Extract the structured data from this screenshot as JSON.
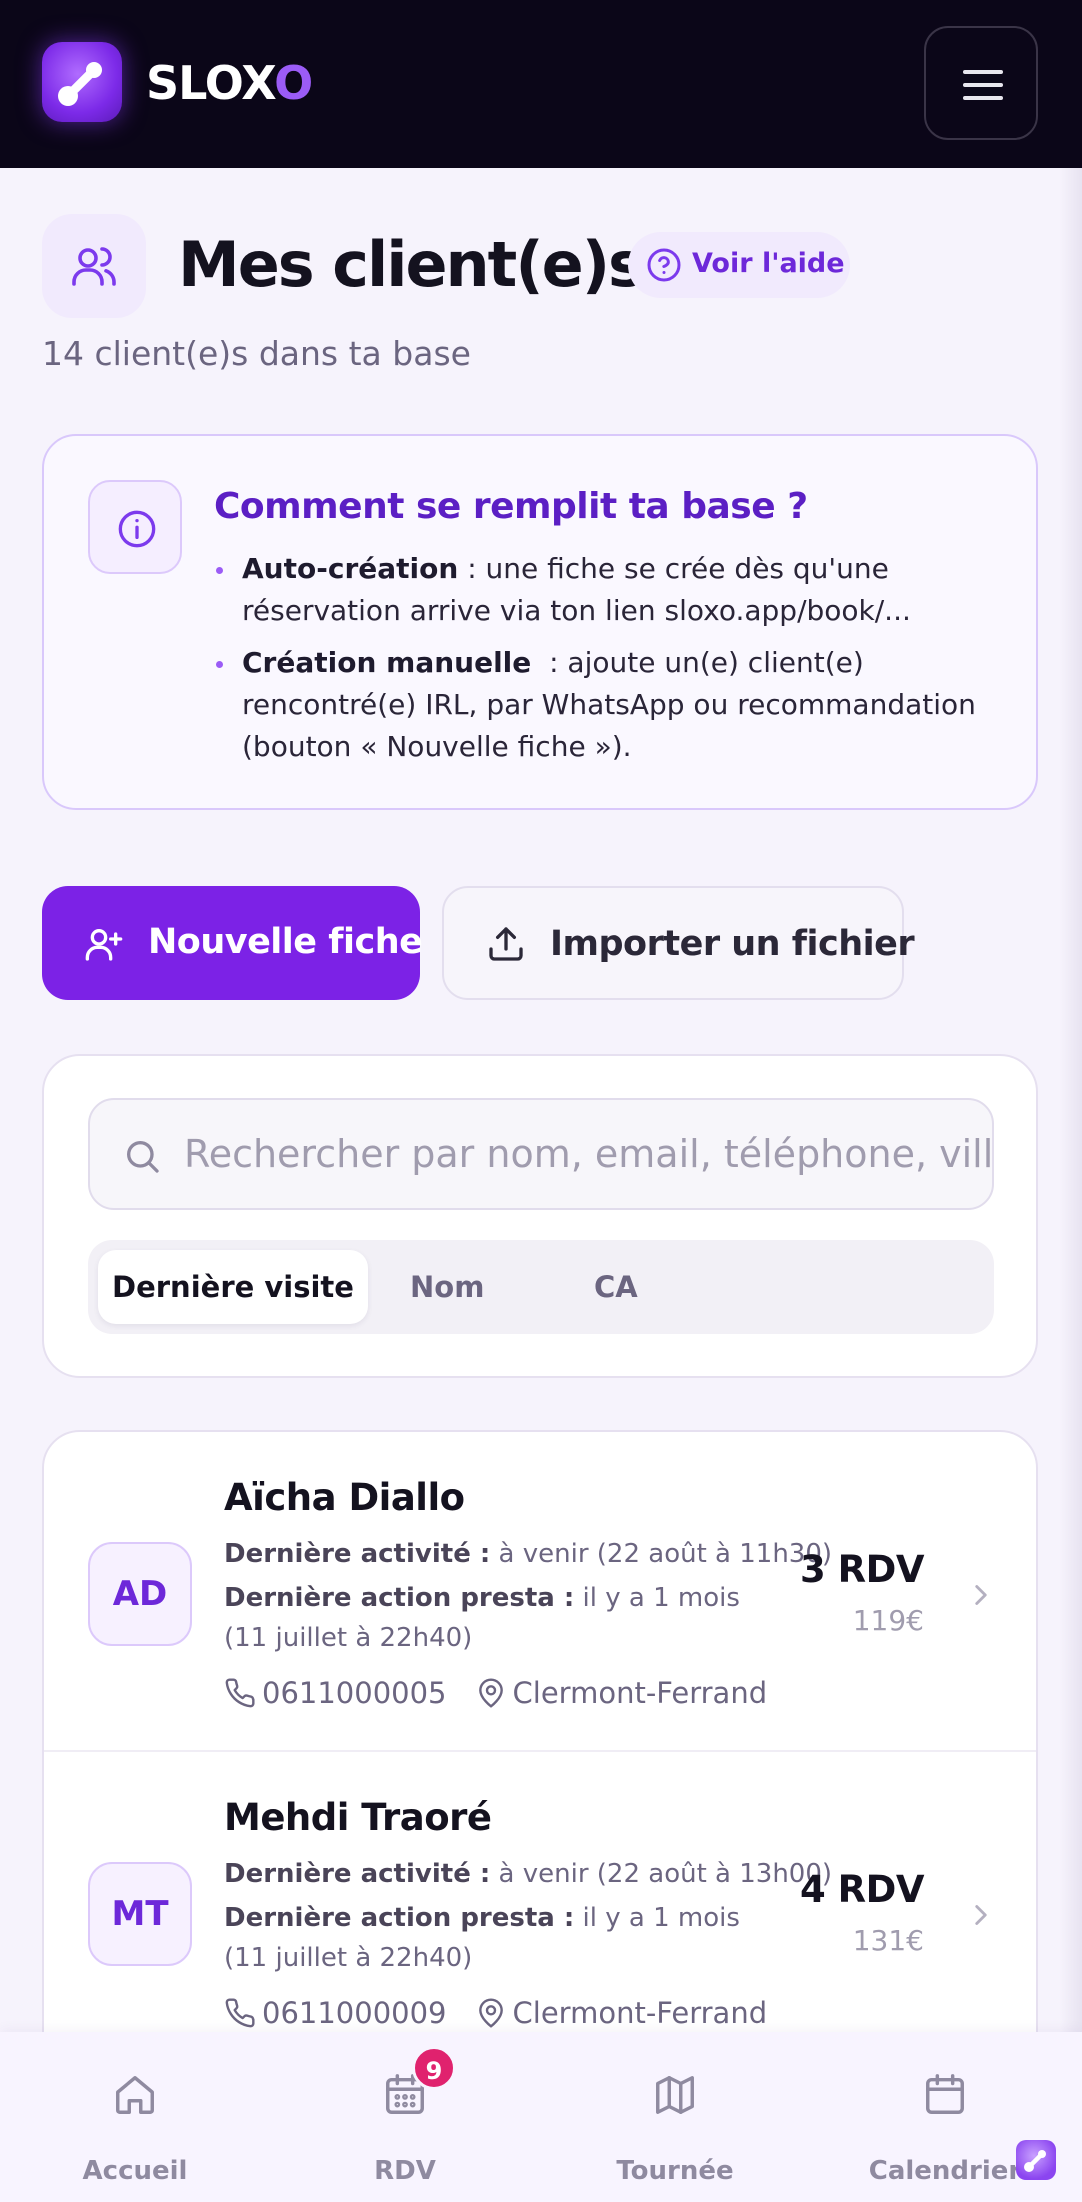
{
  "header": {
    "brand_main": "SLOX",
    "brand_accent": "O",
    "menu_icon": "hamburger-icon"
  },
  "page": {
    "title": "Mes client(e)s",
    "help_label": "Voir l'aide",
    "subtitle": "14 client(e)s dans ta base"
  },
  "info": {
    "title": "Comment se remplit ta base ?",
    "items": [
      {
        "label": "Auto-création",
        "sep": " : ",
        "text": "une fiche se crée dès qu'une réservation arrive via ton lien sloxo.app/book/..."
      },
      {
        "label": "Création manuelle",
        "sep": "  : ",
        "text": "ajoute un(e) client(e) rencontré(e) IRL, par WhatsApp ou recommandation (bouton « Nouvelle fiche »)."
      }
    ]
  },
  "actions": {
    "new_label": "Nouvelle fiche",
    "import_label": "Importer un fichier"
  },
  "search": {
    "placeholder": "Rechercher par nom, email, téléphone, ville...",
    "value": ""
  },
  "sort": {
    "tabs": [
      "Dernière visite",
      "Nom",
      "CA"
    ],
    "active": "Dernière visite"
  },
  "clients": [
    {
      "initials": "AD",
      "name": "Aïcha Diallo",
      "activity_label": "Dernière activité :",
      "activity": " à venir (22 août à 11h30)",
      "presta_label": "Dernière action presta :",
      "presta": " il y a 1 mois (11 juillet à 22h40)",
      "phone": "0611000005",
      "city": "Clermont-Ferrand",
      "rdv": "3 RDV",
      "ca": "119€"
    },
    {
      "initials": "MT",
      "name": "Mehdi Traoré",
      "activity_label": "Dernière activité :",
      "activity": " à venir (22 août à 13h00)",
      "presta_label": "Dernière action presta :",
      "presta": " il y a 1 mois (11 juillet à 22h40)",
      "phone": "0611000009",
      "city": "Clermont-Ferrand",
      "rdv": "4 RDV",
      "ca": "131€"
    }
  ],
  "nav": {
    "items": [
      {
        "label": "Accueil",
        "icon": "home-icon"
      },
      {
        "label": "RDV",
        "icon": "calendar-grid-icon",
        "badge": "9"
      },
      {
        "label": "Tournée",
        "icon": "map-icon"
      },
      {
        "label": "Calendrier",
        "icon": "calendar-icon"
      }
    ]
  },
  "colors": {
    "brand": "#7c22e6",
    "header_bg": "#0b0618",
    "badge": "#e0226e"
  }
}
